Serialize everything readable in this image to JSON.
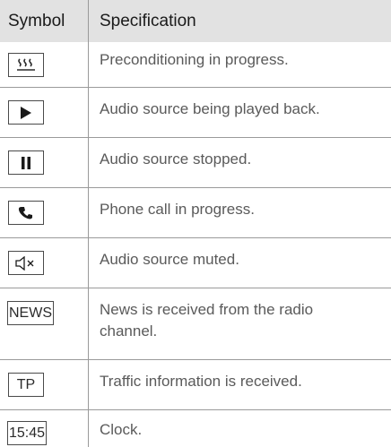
{
  "table": {
    "headers": {
      "symbol": "Symbol",
      "specification": "Specification"
    },
    "rows": [
      {
        "icon": "preconditioning-icon",
        "symbol_text": "",
        "spec": "Preconditioning in progress."
      },
      {
        "icon": "play-icon",
        "symbol_text": "",
        "spec": "Audio source being played back."
      },
      {
        "icon": "pause-icon",
        "symbol_text": "",
        "spec": "Audio source stopped."
      },
      {
        "icon": "phone-icon",
        "symbol_text": "",
        "spec": "Phone call in progress."
      },
      {
        "icon": "speaker-muted-icon",
        "symbol_text": "",
        "spec": "Audio source muted."
      },
      {
        "icon": "",
        "symbol_text": "NEWS",
        "spec": "News is received from the radio channel."
      },
      {
        "icon": "",
        "symbol_text": "TP",
        "spec": "Traffic information is received."
      },
      {
        "icon": "",
        "symbol_text": "15:45",
        "spec": "Clock."
      }
    ]
  },
  "colors": {
    "header_bg": "#e2e2e2",
    "text": "#5a5a5a",
    "header_text": "#1a1a1a",
    "rule": "#9a9a9a"
  }
}
